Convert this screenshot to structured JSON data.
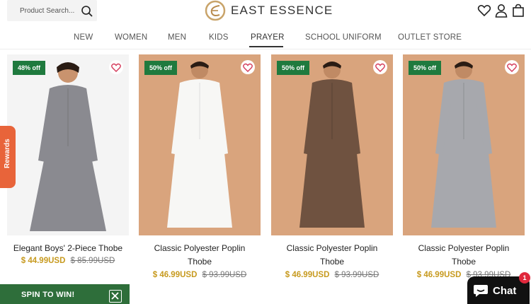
{
  "header": {
    "search_placeholder": "Product Search...",
    "logo_text": "EAST ESSENCE",
    "icons": [
      "search-icon",
      "heart-icon",
      "user-icon",
      "bag-icon"
    ]
  },
  "nav": {
    "items": [
      "NEW",
      "WOMEN",
      "MEN",
      "KIDS",
      "PRAYER",
      "SCHOOL UNIFORM",
      "OUTLET STORE"
    ],
    "active": "PRAYER"
  },
  "products": [
    {
      "badge": "48% off",
      "title_line1": "Elegant Boys' 2-Piece Thobe",
      "title_line2": "",
      "price": "$ 44.99USD",
      "compare": "$ 85.99USD",
      "color": "#8a8a90"
    },
    {
      "badge": "50% off",
      "title_line1": "Classic Polyester Poplin",
      "title_line2": "Thobe",
      "price": "$ 46.99USD",
      "compare": "$ 93.99USD",
      "color": "#f7f7f5"
    },
    {
      "badge": "50% off",
      "title_line1": "Classic Polyester Poplin",
      "title_line2": "Thobe",
      "price": "$ 46.99USD",
      "compare": "$ 93.99USD",
      "color": "#6f5240"
    },
    {
      "badge": "50% off",
      "title_line1": "Classic Polyester Poplin",
      "title_line2": "Thobe",
      "price": "$ 46.99USD",
      "compare": "$ 93.99USD",
      "color": "#a7a8ad"
    }
  ],
  "rewards_label": "Rewards",
  "spin_label": "SPIN TO WIN!",
  "chat": {
    "label": "Chat",
    "count": "1"
  },
  "colors": {
    "badge": "#1f7a3e",
    "price": "#c79a1f",
    "rewards": "#e8643a",
    "spin": "#2e6e3a"
  }
}
